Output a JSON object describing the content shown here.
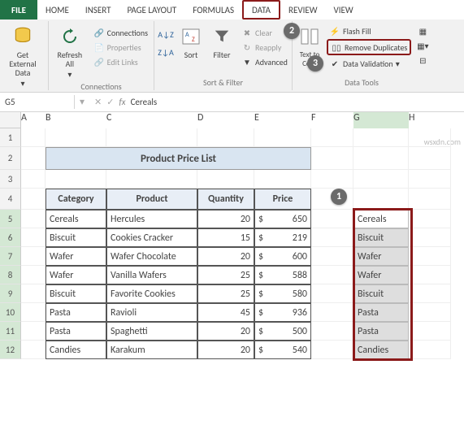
{
  "ribbon": {
    "tabs": {
      "file": "FILE",
      "home": "HOME",
      "insert": "INSERT",
      "page": "PAGE LAYOUT",
      "formulas": "FORMULAS",
      "data": "DATA",
      "review": "REVIEW",
      "view": "VIEW"
    },
    "groups": {
      "getdata": "Get External Data",
      "refresh": "Refresh All",
      "connections_title": "Connections",
      "connections": "Connections",
      "properties": "Properties",
      "editlinks": "Edit Links",
      "sort": "Sort",
      "filter": "Filter",
      "clear": "Clear",
      "reapply": "Reapply",
      "advanced": "Advanced",
      "sortfilter_title": "Sort & Filter",
      "t2c": "Text to Columns",
      "flashfill": "Flash Fill",
      "removedup": "Remove Duplicates",
      "datavalid": "Data Validation",
      "datatools_title": "Data Tools"
    }
  },
  "annotations": {
    "a1": "1",
    "a2": "2",
    "a3": "3"
  },
  "formula": {
    "cellref": "G5",
    "value": "Cereals",
    "fx": "fx"
  },
  "cols": [
    "A",
    "B",
    "C",
    "D",
    "E",
    "F",
    "G",
    "H"
  ],
  "rows": [
    "1",
    "2",
    "3",
    "4",
    "5",
    "6",
    "7",
    "8",
    "9",
    "10",
    "11",
    "12"
  ],
  "table": {
    "title": "Product Price List",
    "headers": {
      "cat": "Category",
      "prod": "Product",
      "qty": "Quantity",
      "price": "Price"
    },
    "rows": [
      {
        "cat": "Cereals",
        "prod": "Hercules",
        "qty": "20",
        "cur": "$",
        "price": "650"
      },
      {
        "cat": "Biscuit",
        "prod": "Cookies Cracker",
        "qty": "15",
        "cur": "$",
        "price": "219"
      },
      {
        "cat": "Wafer",
        "prod": "Wafer Chocolate",
        "qty": "20",
        "cur": "$",
        "price": "600"
      },
      {
        "cat": "Wafer",
        "prod": "Vanilla Wafers",
        "qty": "25",
        "cur": "$",
        "price": "588"
      },
      {
        "cat": "Biscuit",
        "prod": "Favorite Cookies",
        "qty": "25",
        "cur": "$",
        "price": "580"
      },
      {
        "cat": "Pasta",
        "prod": "Ravioli",
        "qty": "45",
        "cur": "$",
        "price": "936"
      },
      {
        "cat": "Pasta",
        "prod": "Spaghetti",
        "qty": "20",
        "cur": "$",
        "price": "500"
      },
      {
        "cat": "Candies",
        "prod": "Karakum",
        "qty": "20",
        "cur": "$",
        "price": "540"
      }
    ]
  },
  "selection": [
    "Cereals",
    "Biscuit",
    "Wafer",
    "Wafer",
    "Biscuit",
    "Pasta",
    "Pasta",
    "Candies"
  ],
  "watermark": "wsxdn.com"
}
